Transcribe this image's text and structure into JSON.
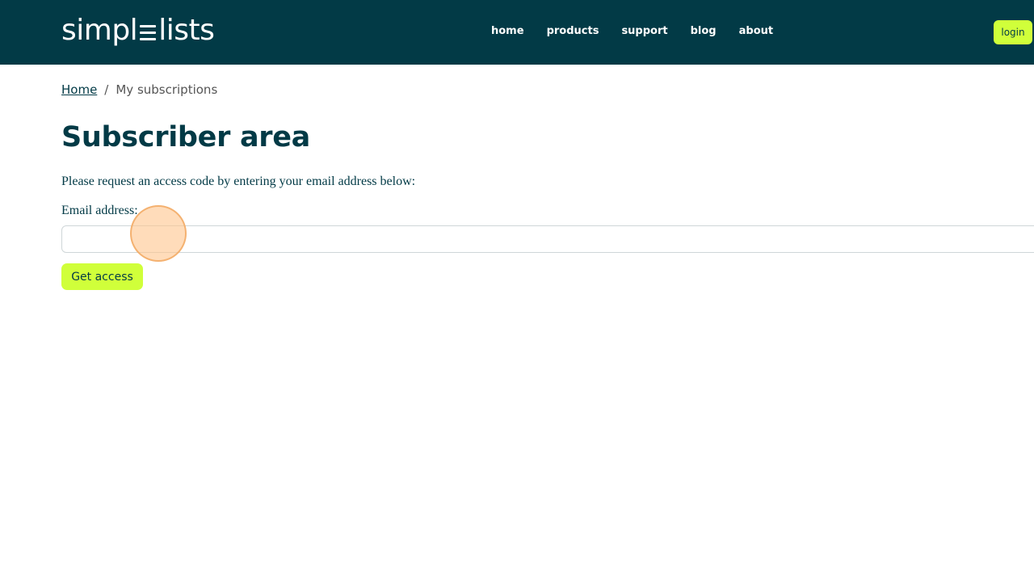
{
  "header": {
    "logo": {
      "left": "simpl",
      "right": "lists"
    },
    "nav": [
      {
        "label": "home"
      },
      {
        "label": "products"
      },
      {
        "label": "support"
      },
      {
        "label": "blog"
      },
      {
        "label": "about"
      }
    ],
    "login_label": "login"
  },
  "breadcrumb": {
    "home": "Home",
    "separator": "/",
    "current": "My subscriptions"
  },
  "main": {
    "title": "Subscriber area",
    "intro": "Please request an access code by entering your email address below:",
    "email_label": "Email address:",
    "email_value": "",
    "submit_label": "Get access"
  },
  "colors": {
    "header_bg": "#023a46",
    "accent": "#d0ff3a",
    "text": "#023a46"
  }
}
